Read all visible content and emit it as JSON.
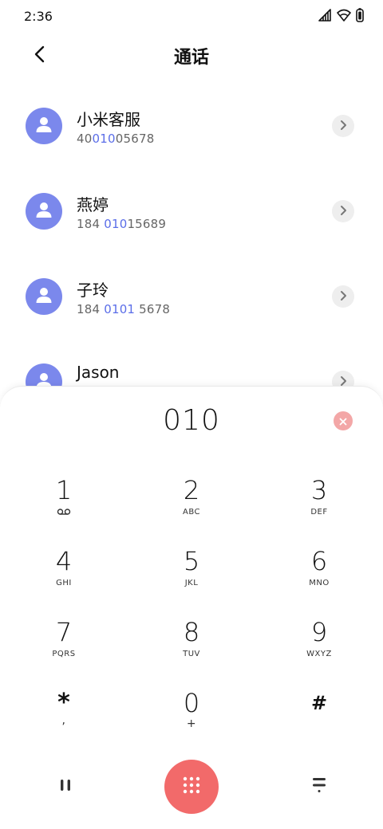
{
  "status_bar": {
    "time": "2:36"
  },
  "header": {
    "title": "通话"
  },
  "contacts": [
    {
      "name": "小米客服",
      "number_parts": [
        "40",
        "010",
        "05678"
      ]
    },
    {
      "name": "燕婷",
      "number_parts": [
        "184 ",
        "010",
        "15689"
      ]
    },
    {
      "name": "子玲",
      "number_parts": [
        "184 ",
        "0101",
        " 5678"
      ]
    },
    {
      "name": "Jason",
      "number_parts": [
        "",
        "",
        ""
      ]
    }
  ],
  "dialer": {
    "input": "010",
    "keys": [
      {
        "digit": "1",
        "letters": ""
      },
      {
        "digit": "2",
        "letters": "ABC"
      },
      {
        "digit": "3",
        "letters": "DEF"
      },
      {
        "digit": "4",
        "letters": "GHI"
      },
      {
        "digit": "5",
        "letters": "JKL"
      },
      {
        "digit": "6",
        "letters": "MNO"
      },
      {
        "digit": "7",
        "letters": "PQRS"
      },
      {
        "digit": "8",
        "letters": "TUV"
      },
      {
        "digit": "9",
        "letters": "WXYZ"
      },
      {
        "digit": "*",
        "letters": ","
      },
      {
        "digit": "0",
        "letters": "+"
      },
      {
        "digit": "#",
        "letters": ""
      }
    ]
  },
  "colors": {
    "accent": "#5b6ee8",
    "avatar": "#7b88ec",
    "dial_button": "#f26a6a",
    "clear_button": "#f3a7a7"
  }
}
